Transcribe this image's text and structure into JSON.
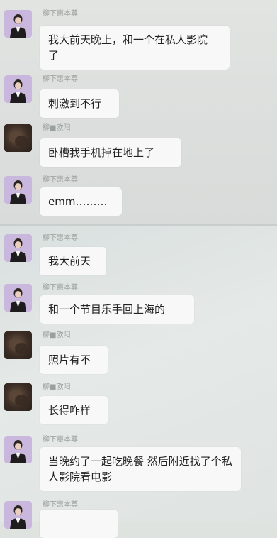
{
  "messages": [
    {
      "sender": "柳下惠本尊",
      "avatar": "person-avatar",
      "text": "我大前天晚上，和一个在私人影院 了"
    },
    {
      "sender": "柳下惠本尊",
      "avatar": "person-avatar",
      "text": "刺激到不行"
    },
    {
      "sender": "柳■欧阳",
      "avatar": "dark-avatar",
      "text": "卧槽我手机掉在地上了"
    },
    {
      "sender": "柳下惠本尊",
      "avatar": "person-avatar",
      "text": "emm………"
    },
    {
      "sender": "柳下惠本尊",
      "avatar": "person-avatar",
      "text": "我大前天"
    },
    {
      "sender": "柳下惠本尊",
      "avatar": "person-avatar",
      "text": "和一个节目乐手回上海的"
    },
    {
      "sender": "柳■欧阳",
      "avatar": "dark-avatar",
      "text": "照片有不"
    },
    {
      "sender": "柳■欧阳",
      "avatar": "dark-avatar",
      "text": "长得咋样"
    },
    {
      "sender": "柳下惠本尊",
      "avatar": "person-avatar",
      "text": "当晚约了一起吃晚餐 然后附近找了个私人影院看电影"
    },
    {
      "sender": "柳下惠本尊",
      "avatar": "person-avatar",
      "text": ""
    }
  ]
}
